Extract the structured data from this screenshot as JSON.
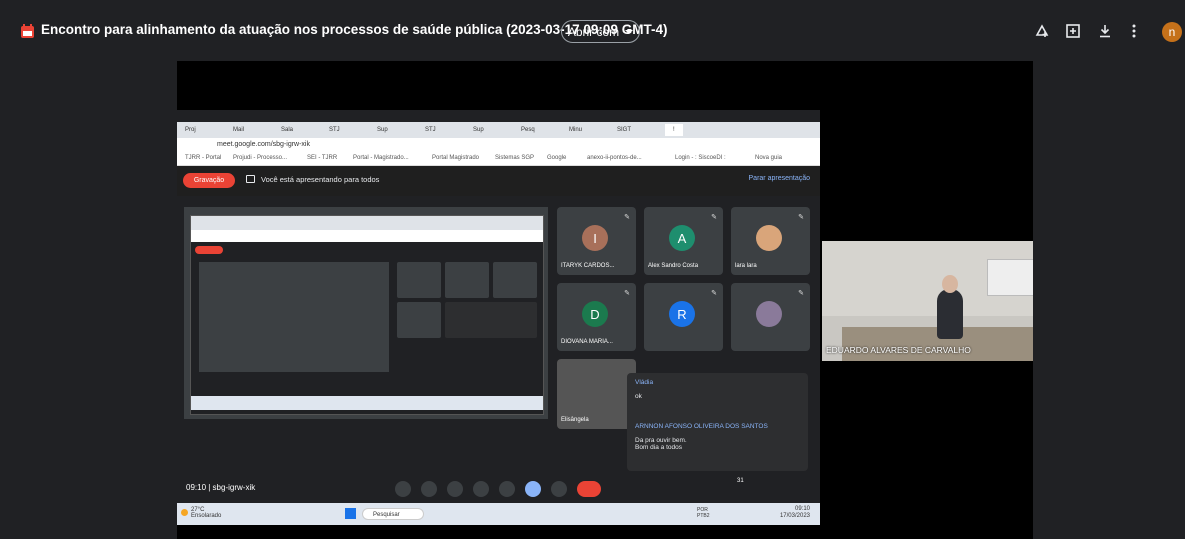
{
  "header": {
    "title": "Encontro para alinhamento da atuação nos processos de saúde pública (2023-03-17 09:09 GMT-4)",
    "open_with_label": "Abrir com",
    "avatar_initial": "n",
    "icons": [
      "add-to-drive-icon",
      "new-window-icon",
      "download-icon",
      "more-vert-icon"
    ]
  },
  "browser": {
    "tabs": [
      "Proj",
      "Mail",
      "Sala",
      "STJ",
      "Sup",
      "STJ",
      "Sup",
      "Pesq",
      "Minu",
      "SIGT",
      "!"
    ],
    "url": "meet.google.com/sbg-igrw-xik",
    "bookmarks": [
      "TJRR - Portal",
      "Projudi - Processo...",
      "SEI - TJRR",
      "Portal - Magistrado...",
      "Portal Magistrado",
      "Sistemas SGP",
      "Google",
      "anexo-ii-pontos-de...",
      "Login - : SiscoeDI :",
      "Nova guia"
    ]
  },
  "meet": {
    "recording_label": "Gravação",
    "presenting_text": "Você está apresentando para todos",
    "stop_presenting_label": "Parar apresentação",
    "meeting_code": "09:10 | sbg-igrw-xik",
    "participant_count": "31"
  },
  "participants": [
    {
      "name": "ITARYK CARDOS...",
      "initial": "I",
      "color": "#a8705a"
    },
    {
      "name": "Alex Sandro Costa",
      "initial": "A",
      "color": "#1e8e6e"
    },
    {
      "name": "lara lara",
      "initial": "",
      "color": "#d9a57a"
    },
    {
      "name": "DIOVANA MARIA...",
      "initial": "D",
      "color": "#1b7a4e"
    },
    {
      "name": "",
      "initial": "R",
      "color": "#1a73e8"
    },
    {
      "name": "",
      "initial": "",
      "color": "#8a7a9a"
    },
    {
      "name": "Elisângela",
      "initial": "",
      "color": "#555"
    }
  ],
  "chat": [
    {
      "author": "Vládia",
      "text": "ok"
    },
    {
      "author": "ARNNON AFONSO OLIVEIRA DOS SANTOS",
      "text": "Da pra ouvir bem.\nBom dia a todos"
    }
  ],
  "taskbar": {
    "weather": "27°C\nEnsolarado",
    "search_placeholder": "Pesquisar",
    "lang": "POR\nPTB2",
    "time": "09:10\n17/03/2023"
  },
  "camera": {
    "speaker_label": "EDUARDO ALVARES DE CARVALHO"
  }
}
